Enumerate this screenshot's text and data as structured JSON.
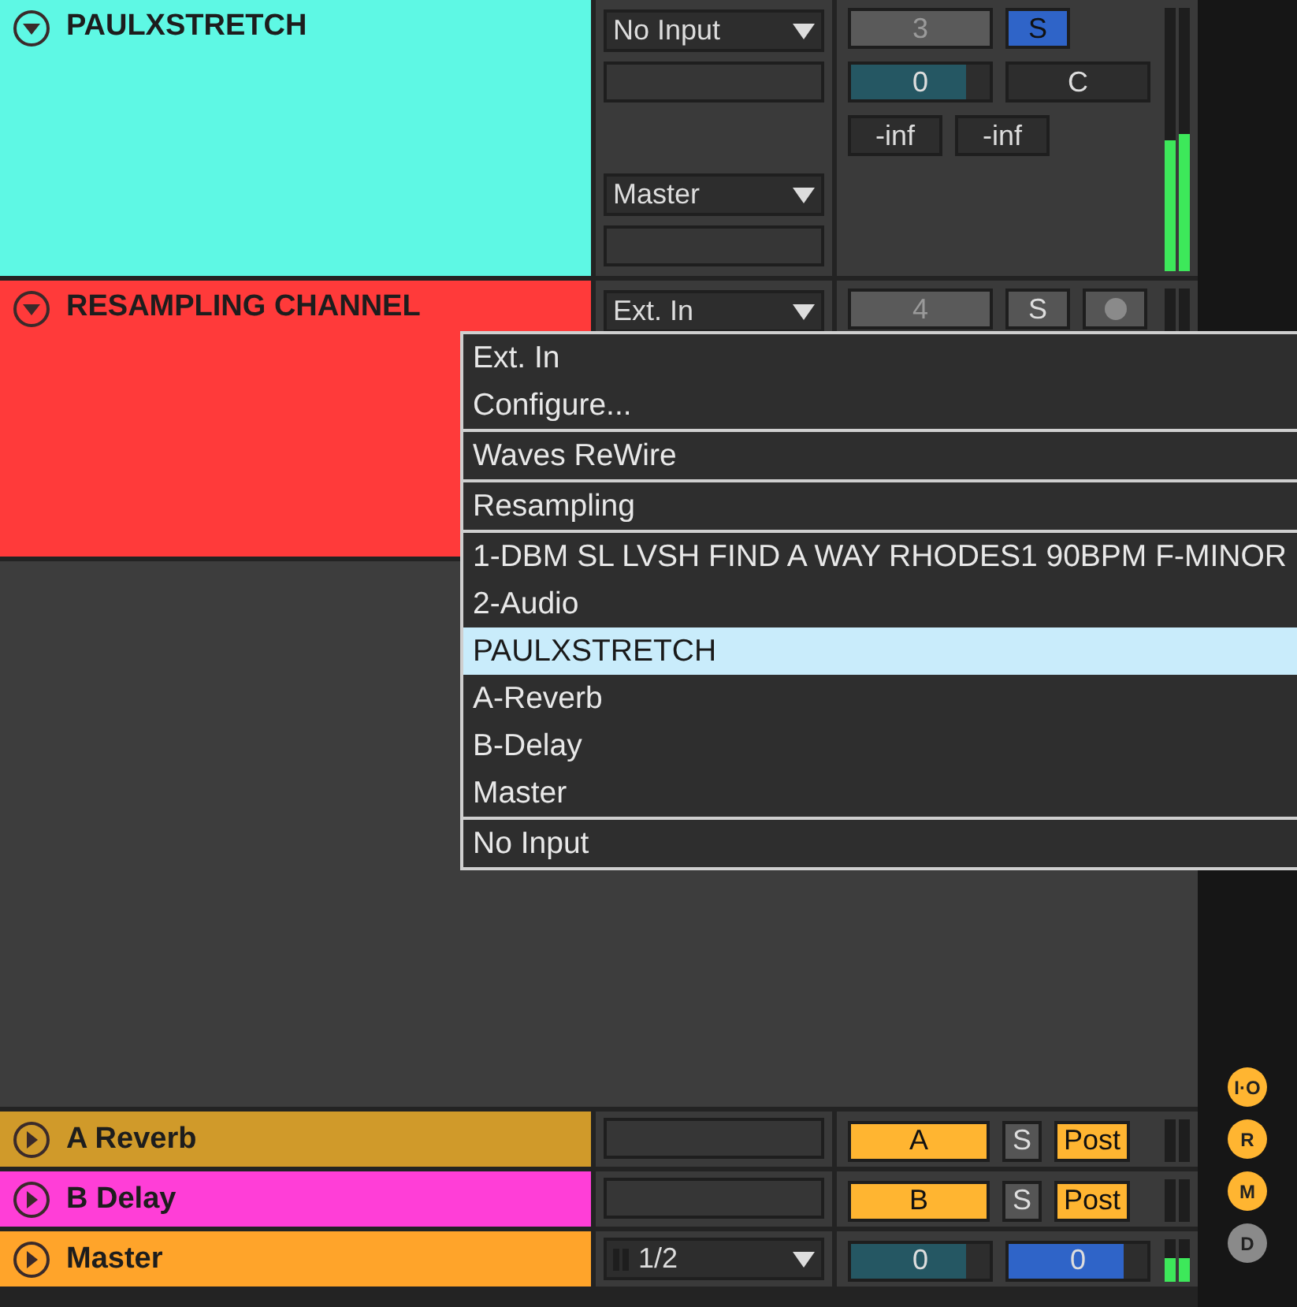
{
  "tracks": [
    {
      "kind": "audio",
      "name": "PAULXSTRETCH",
      "color": "#5ef8e4",
      "expanded": true,
      "input": "No Input",
      "output": "Master",
      "number": "3",
      "solo": {
        "label": "S",
        "selected": true
      },
      "volume": {
        "reading": "0",
        "level": 0.83
      },
      "pan": "C",
      "peaks": [
        "-inf",
        "-inf"
      ],
      "meter": [
        {
          "level": 0.5
        },
        {
          "level": 0.52
        }
      ]
    },
    {
      "kind": "audio",
      "name": "RESAMPLING CHANNEL",
      "color": "#ff3a3a",
      "expanded": true,
      "input": "Ext. In",
      "number": "4",
      "solo": {
        "label": "S",
        "selected": false
      },
      "arm": false
    },
    {
      "kind": "return",
      "name": "A Reverb",
      "color": "#d09a2a",
      "expanded": false,
      "send": "A",
      "solo": {
        "label": "S",
        "selected": false
      },
      "post": "Post"
    },
    {
      "kind": "return",
      "name": "B Delay",
      "color": "#ff3ed7",
      "expanded": false,
      "send": "B",
      "solo": {
        "label": "S",
        "selected": false
      },
      "post": "Post"
    },
    {
      "kind": "master",
      "name": "Master",
      "color": "#ffa42a",
      "expanded": false,
      "input": "1/2",
      "volume": {
        "reading": "0",
        "level": 0.83
      },
      "cue": {
        "reading": "0",
        "level": 0.83
      },
      "meter": [
        {
          "level": 0.55
        },
        {
          "level": 0.55
        }
      ]
    }
  ],
  "side_buttons": [
    {
      "label": "I·O",
      "on": true
    },
    {
      "label": "R",
      "on": true
    },
    {
      "label": "M",
      "on": true
    },
    {
      "label": "D",
      "on": false
    }
  ],
  "input_menu": {
    "groups": [
      [
        {
          "label": "Ext. In",
          "selected": false
        },
        {
          "label": "Configure...",
          "selected": false
        }
      ],
      [
        {
          "label": "Waves ReWire",
          "selected": false
        }
      ],
      [
        {
          "label": "Resampling",
          "selected": false
        }
      ],
      [
        {
          "label": "1-DBM SL LVSH FIND A WAY RHODES1 90BPM F-MINOR",
          "selected": false
        },
        {
          "label": "2-Audio",
          "selected": false
        },
        {
          "label": "PAULXSTRETCH",
          "selected": true
        },
        {
          "label": "A-Reverb",
          "selected": false
        },
        {
          "label": "B-Delay",
          "selected": false
        },
        {
          "label": "Master",
          "selected": false
        }
      ],
      [
        {
          "label": "No Input",
          "selected": false
        }
      ]
    ]
  }
}
